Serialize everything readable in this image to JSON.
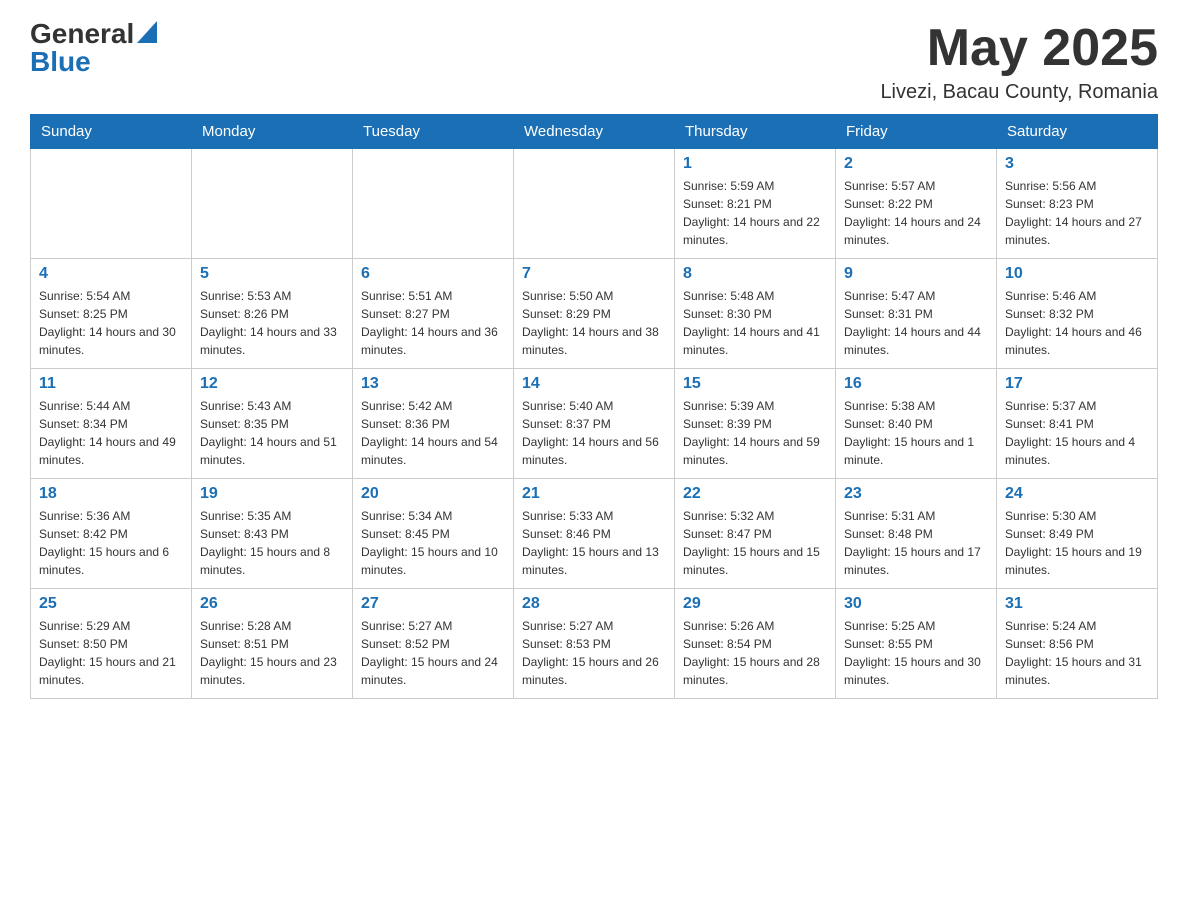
{
  "header": {
    "logo_general": "General",
    "logo_blue": "Blue",
    "month_title": "May 2025",
    "location": "Livezi, Bacau County, Romania"
  },
  "weekdays": [
    "Sunday",
    "Monday",
    "Tuesday",
    "Wednesday",
    "Thursday",
    "Friday",
    "Saturday"
  ],
  "weeks": [
    [
      {
        "day": "",
        "info": ""
      },
      {
        "day": "",
        "info": ""
      },
      {
        "day": "",
        "info": ""
      },
      {
        "day": "",
        "info": ""
      },
      {
        "day": "1",
        "info": "Sunrise: 5:59 AM\nSunset: 8:21 PM\nDaylight: 14 hours and 22 minutes."
      },
      {
        "day": "2",
        "info": "Sunrise: 5:57 AM\nSunset: 8:22 PM\nDaylight: 14 hours and 24 minutes."
      },
      {
        "day": "3",
        "info": "Sunrise: 5:56 AM\nSunset: 8:23 PM\nDaylight: 14 hours and 27 minutes."
      }
    ],
    [
      {
        "day": "4",
        "info": "Sunrise: 5:54 AM\nSunset: 8:25 PM\nDaylight: 14 hours and 30 minutes."
      },
      {
        "day": "5",
        "info": "Sunrise: 5:53 AM\nSunset: 8:26 PM\nDaylight: 14 hours and 33 minutes."
      },
      {
        "day": "6",
        "info": "Sunrise: 5:51 AM\nSunset: 8:27 PM\nDaylight: 14 hours and 36 minutes."
      },
      {
        "day": "7",
        "info": "Sunrise: 5:50 AM\nSunset: 8:29 PM\nDaylight: 14 hours and 38 minutes."
      },
      {
        "day": "8",
        "info": "Sunrise: 5:48 AM\nSunset: 8:30 PM\nDaylight: 14 hours and 41 minutes."
      },
      {
        "day": "9",
        "info": "Sunrise: 5:47 AM\nSunset: 8:31 PM\nDaylight: 14 hours and 44 minutes."
      },
      {
        "day": "10",
        "info": "Sunrise: 5:46 AM\nSunset: 8:32 PM\nDaylight: 14 hours and 46 minutes."
      }
    ],
    [
      {
        "day": "11",
        "info": "Sunrise: 5:44 AM\nSunset: 8:34 PM\nDaylight: 14 hours and 49 minutes."
      },
      {
        "day": "12",
        "info": "Sunrise: 5:43 AM\nSunset: 8:35 PM\nDaylight: 14 hours and 51 minutes."
      },
      {
        "day": "13",
        "info": "Sunrise: 5:42 AM\nSunset: 8:36 PM\nDaylight: 14 hours and 54 minutes."
      },
      {
        "day": "14",
        "info": "Sunrise: 5:40 AM\nSunset: 8:37 PM\nDaylight: 14 hours and 56 minutes."
      },
      {
        "day": "15",
        "info": "Sunrise: 5:39 AM\nSunset: 8:39 PM\nDaylight: 14 hours and 59 minutes."
      },
      {
        "day": "16",
        "info": "Sunrise: 5:38 AM\nSunset: 8:40 PM\nDaylight: 15 hours and 1 minute."
      },
      {
        "day": "17",
        "info": "Sunrise: 5:37 AM\nSunset: 8:41 PM\nDaylight: 15 hours and 4 minutes."
      }
    ],
    [
      {
        "day": "18",
        "info": "Sunrise: 5:36 AM\nSunset: 8:42 PM\nDaylight: 15 hours and 6 minutes."
      },
      {
        "day": "19",
        "info": "Sunrise: 5:35 AM\nSunset: 8:43 PM\nDaylight: 15 hours and 8 minutes."
      },
      {
        "day": "20",
        "info": "Sunrise: 5:34 AM\nSunset: 8:45 PM\nDaylight: 15 hours and 10 minutes."
      },
      {
        "day": "21",
        "info": "Sunrise: 5:33 AM\nSunset: 8:46 PM\nDaylight: 15 hours and 13 minutes."
      },
      {
        "day": "22",
        "info": "Sunrise: 5:32 AM\nSunset: 8:47 PM\nDaylight: 15 hours and 15 minutes."
      },
      {
        "day": "23",
        "info": "Sunrise: 5:31 AM\nSunset: 8:48 PM\nDaylight: 15 hours and 17 minutes."
      },
      {
        "day": "24",
        "info": "Sunrise: 5:30 AM\nSunset: 8:49 PM\nDaylight: 15 hours and 19 minutes."
      }
    ],
    [
      {
        "day": "25",
        "info": "Sunrise: 5:29 AM\nSunset: 8:50 PM\nDaylight: 15 hours and 21 minutes."
      },
      {
        "day": "26",
        "info": "Sunrise: 5:28 AM\nSunset: 8:51 PM\nDaylight: 15 hours and 23 minutes."
      },
      {
        "day": "27",
        "info": "Sunrise: 5:27 AM\nSunset: 8:52 PM\nDaylight: 15 hours and 24 minutes."
      },
      {
        "day": "28",
        "info": "Sunrise: 5:27 AM\nSunset: 8:53 PM\nDaylight: 15 hours and 26 minutes."
      },
      {
        "day": "29",
        "info": "Sunrise: 5:26 AM\nSunset: 8:54 PM\nDaylight: 15 hours and 28 minutes."
      },
      {
        "day": "30",
        "info": "Sunrise: 5:25 AM\nSunset: 8:55 PM\nDaylight: 15 hours and 30 minutes."
      },
      {
        "day": "31",
        "info": "Sunrise: 5:24 AM\nSunset: 8:56 PM\nDaylight: 15 hours and 31 minutes."
      }
    ]
  ]
}
